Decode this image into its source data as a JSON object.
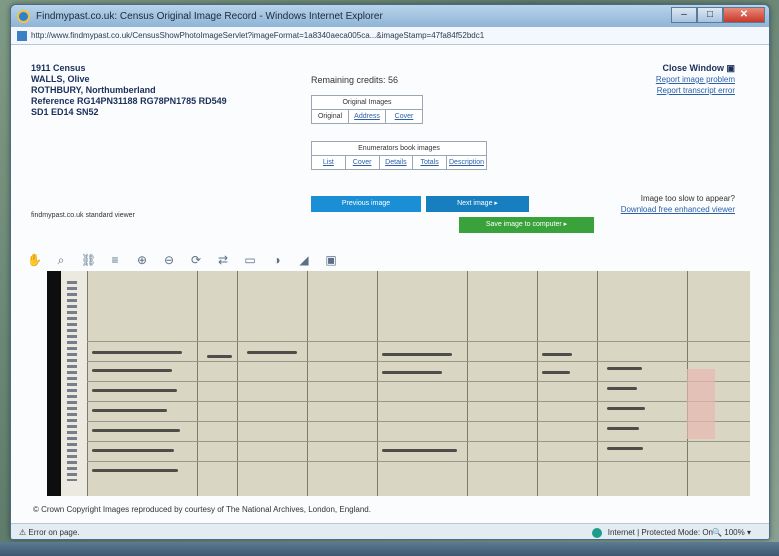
{
  "window": {
    "title": "Findmypast.co.uk: Census Original Image Record - Windows Internet Explorer",
    "url": "http://www.findmypast.co.uk/CensusShowPhotoImageServlet?imageFormat=1a8340aeca005ca...&imageStamp=47fa84f52bdc1"
  },
  "record": {
    "year_label": "1911 Census",
    "name": "WALLS, Olive",
    "place": "ROTHBURY, Northumberland",
    "reference": "Reference RG14PN31188 RG78PN1785 RD549",
    "sd": "SD1 ED14 SN52"
  },
  "credits": "Remaining credits: 56",
  "original_images": {
    "header": "Original Images",
    "links": [
      "Original",
      "Address",
      "Cover"
    ]
  },
  "enumerators": {
    "header": "Enumerators book images",
    "links": [
      "List",
      "Cover",
      "Details",
      "Totals",
      "Description"
    ]
  },
  "right_panel": {
    "close": "Close Window",
    "report_problem": "Report image problem",
    "report_transcript": "Report transcript error",
    "slow_q": "Image too slow to appear?",
    "download": "Download free enhanced viewer"
  },
  "viewer_label": "findmypast.co.uk standard viewer",
  "buttons": {
    "prev": "Previous image",
    "next": "Next image",
    "save": "Save image to computer"
  },
  "copyright": "© Crown Copyright Images reproduced by courtesy of The National Archives, London, England.",
  "status": {
    "left": "Error on page.",
    "zone": "Internet | Protected Mode: On",
    "zoom": "100%"
  },
  "colors": {
    "link": "#2b5fa8",
    "prev_button": "#1a8fd6",
    "next_button": "#177fc0",
    "save_button": "#39a23a"
  }
}
